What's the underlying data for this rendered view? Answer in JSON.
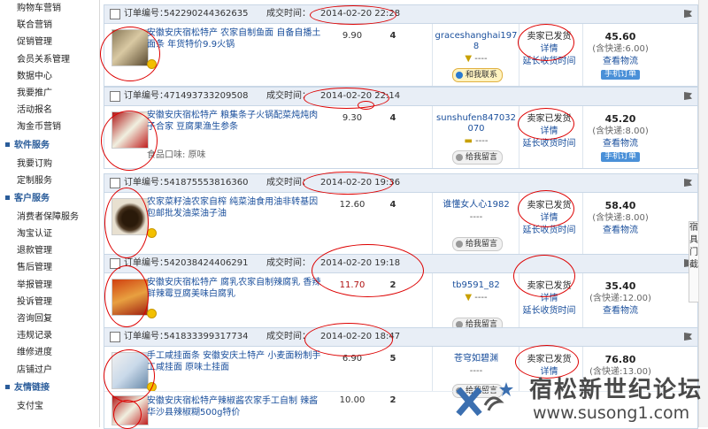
{
  "sidebar": {
    "top_items": [
      "购物车营销",
      "联合营销",
      "促销管理",
      "会员关系管理",
      "数据中心",
      "我要推广",
      "活动报名",
      "淘金币营销"
    ],
    "sections": [
      {
        "title": "软件服务",
        "items": [
          "我要订购",
          "定制服务"
        ]
      },
      {
        "title": "客户服务",
        "items": [
          "消费者保障服务",
          "淘宝认证",
          "退款管理",
          "售后管理",
          "举报管理",
          "投诉管理",
          "咨询回复",
          "违规记录",
          "维修进度",
          "店铺过户"
        ]
      },
      {
        "title": "友情链接",
        "items": [
          "支付宝"
        ]
      }
    ]
  },
  "labels": {
    "order_no": "订单编号：",
    "deal_time": "成交时间：",
    "contact": "和我联系",
    "leave_msg": "给我留言",
    "shipped": "卖家已发货",
    "detail": "详情",
    "extend": "延长收货时间",
    "logistics": "查看物流",
    "mobile_order": "手机订单"
  },
  "orders": [
    {
      "order_no": "542290244362635",
      "time": "2014-02-20 22:28",
      "title": "安徽安庆宿松特产 农家自制鱼面 自备自播土面条 年货特价9.9火锅",
      "attr": "",
      "price": "9.90",
      "qty": "4",
      "buyer": "graceshanghai1978",
      "contact": "和我联系",
      "amount": "45.60",
      "ship": "(含快递:6.00)",
      "mobile": true
    },
    {
      "order_no": "471493733209508",
      "time": "2014-02-20 22:14",
      "title": "安徽安庆宿松特产 粮集条子火锅配菜炖炖肉子合家 豆腐果渔生参条",
      "attr": "食品口味: 原味",
      "price": "9.30",
      "qty": "4",
      "buyer": "sunshufen847032070",
      "contact": "给我留言",
      "amount": "45.20",
      "ship": "(含快递:8.00)",
      "mobile": true
    },
    {
      "order_no": "541875553816360",
      "time": "2014-02-20 19:36",
      "title": "农家菜籽油农家自榨 纯菜油食用油非转基因包邮批发油菜油子油",
      "attr": "",
      "price": "12.60",
      "qty": "4",
      "buyer": "谁懂女人心1982",
      "contact": "给我留言",
      "amount": "58.40",
      "ship": "(含快递:8.00)",
      "mobile": false
    },
    {
      "order_no": "542038424406291",
      "time": "2014-02-20 19:18",
      "title": "安徽安庆宿松特产 腐乳农家自制辣腐乳 香辣鲜辣霉豆腐美味白腐乳",
      "attr": "",
      "price": "11.70",
      "qty": "2",
      "buyer": "tb9591_82",
      "contact": "给我留言",
      "amount": "35.40",
      "ship": "(含快递:12.00)",
      "mobile": false
    },
    {
      "order_no": "541833399317734",
      "time": "2014-02-20 18:47",
      "title": "手工咸挂面条 安徽安庆土特产 小麦面粉制手工咸挂面 原味土挂面",
      "attr": "",
      "price": "6.90",
      "qty": "5",
      "buyer": "苍穹如碧渊",
      "contact": "给我留言",
      "amount": "76.80",
      "ship": "(含快递:13.00)",
      "mobile": false
    },
    {
      "order_no": "",
      "time": "",
      "title": "安徽安庆宿松特产辣椒酱农家手工自制 辣酱 华沙县辣椒糊500g特价",
      "attr": "",
      "price": "10.00",
      "qty": "2",
      "buyer": "",
      "contact": "",
      "amount": "",
      "ship": "",
      "mobile": false
    }
  ],
  "side_peek": "宿 具 门 截",
  "watermark": {
    "name": "宿松新世纪论坛",
    "url": "www.susong1.com"
  }
}
